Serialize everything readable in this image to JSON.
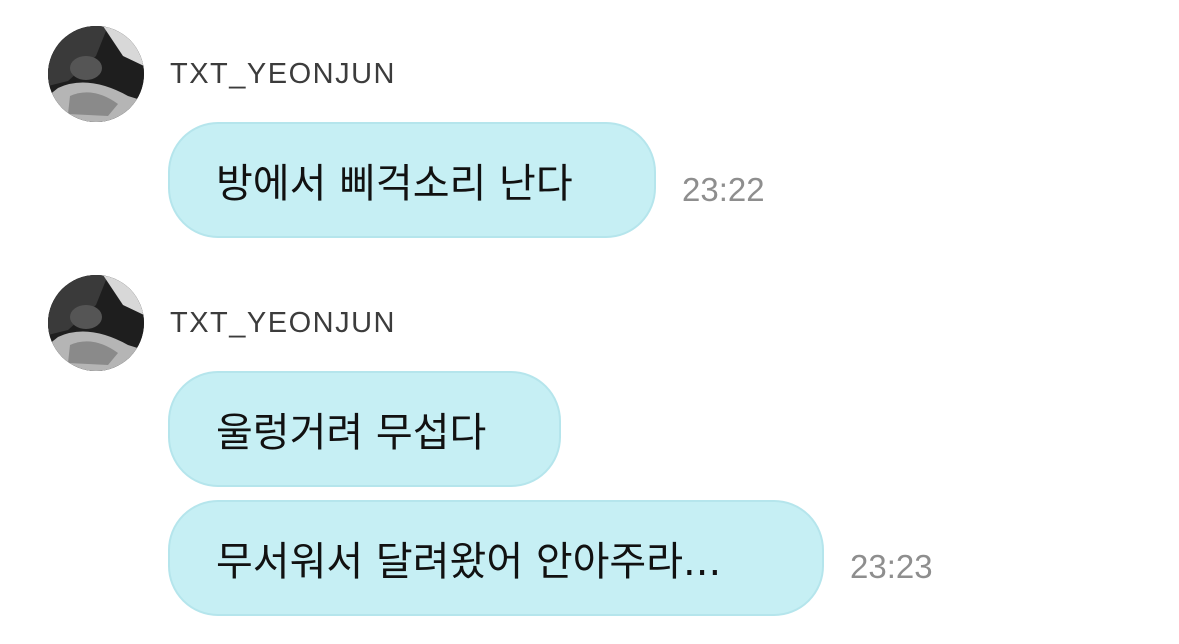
{
  "chat": {
    "messages": [
      {
        "sender": "TXT_YEONJUN",
        "bubbles": [
          {
            "text": "방에서 삐걱소리 난다",
            "time": "23:22"
          }
        ]
      },
      {
        "sender": "TXT_YEONJUN",
        "bubbles": [
          {
            "text": "울렁거려 무섭다",
            "time": ""
          },
          {
            "text": "무서워서 달려왔어 안아주라...",
            "time": "23:23"
          }
        ]
      }
    ]
  },
  "colors": {
    "bubble_background": "#c6eff4",
    "sender_text": "#3c3c3c",
    "timestamp_text": "#8e8e8e"
  },
  "icons": {
    "avatar": "profile-photo"
  }
}
